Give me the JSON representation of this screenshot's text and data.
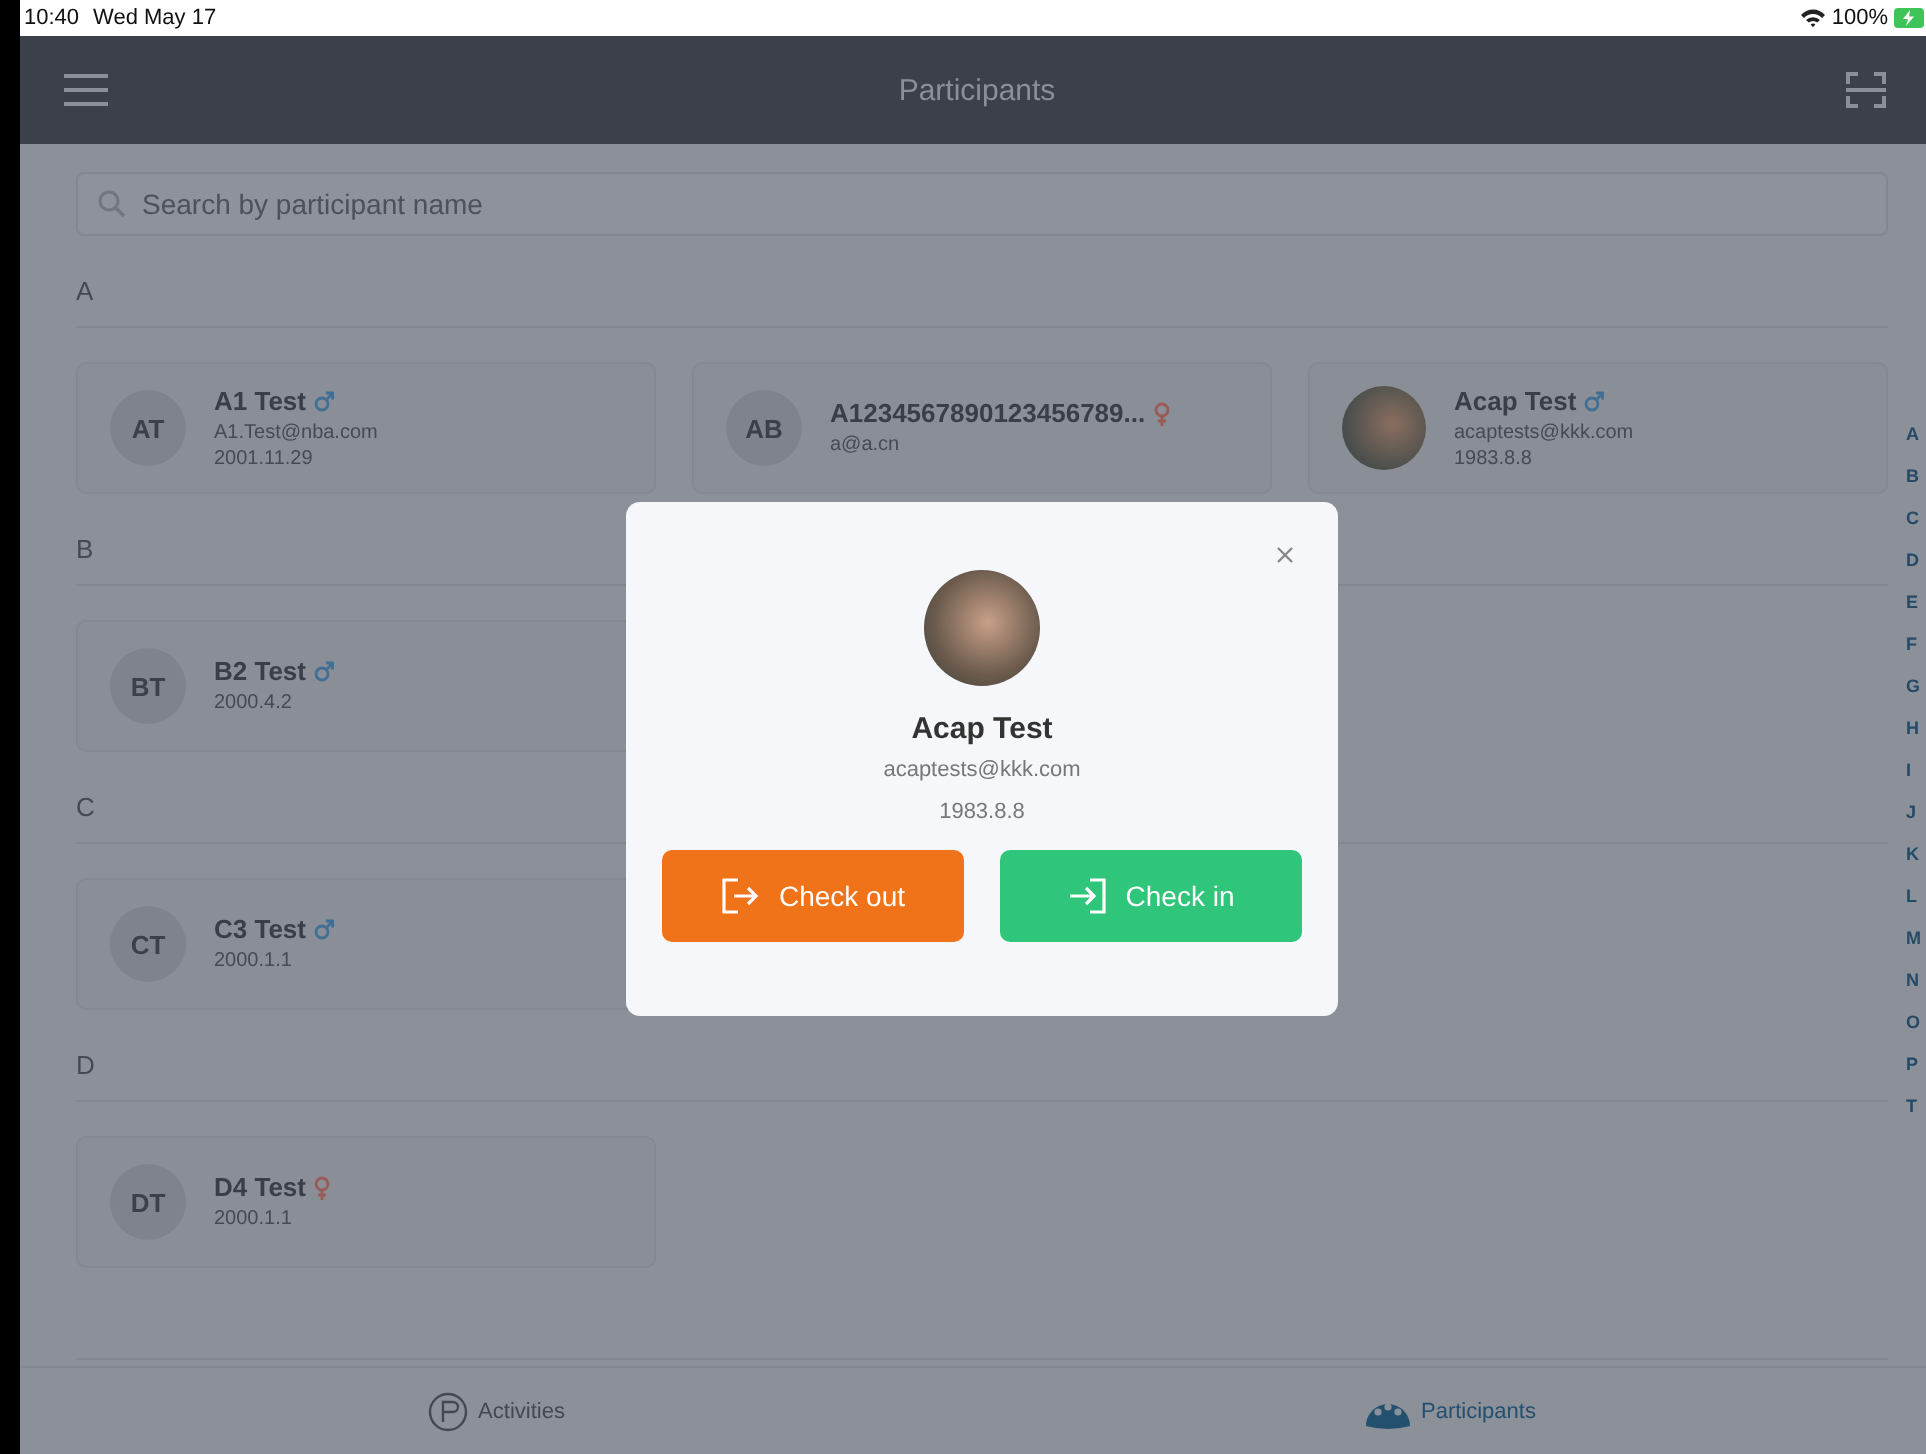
{
  "status_bar": {
    "time": "10:40",
    "date": "Wed May 17",
    "battery": "100%"
  },
  "header": {
    "title": "Participants"
  },
  "search": {
    "placeholder": "Search by participant name"
  },
  "sections": [
    {
      "letter": "A",
      "participants": [
        {
          "name": "A1 Test",
          "kind": "male",
          "avatar": {
            "kind": "initials",
            "text": "AT"
          },
          "lines": [
            "A1.Test@nba.com",
            "2001.11.29"
          ]
        },
        {
          "name": "A1234567890123456789...",
          "kind": "female",
          "avatar": {
            "kind": "initials",
            "text": "AB"
          },
          "lines": [
            "a@a.cn"
          ]
        },
        {
          "name": "Acap Test",
          "kind": "male",
          "avatar": {
            "kind": "photo"
          },
          "lines": [
            "acaptests@kkk.com",
            "1983.8.8"
          ]
        }
      ]
    },
    {
      "letter": "B",
      "participants": [
        {
          "name": "B2 Test",
          "kind": "male",
          "avatar": {
            "kind": "initials",
            "text": "BT"
          },
          "lines": [
            "2000.4.2"
          ]
        }
      ]
    },
    {
      "letter": "C",
      "participants": [
        {
          "name": "C3 Test",
          "kind": "male",
          "avatar": {
            "kind": "initials",
            "text": "CT"
          },
          "lines": [
            "2000.1.1"
          ]
        }
      ]
    },
    {
      "letter": "D",
      "participants": [
        {
          "name": "D4 Test",
          "kind": "female",
          "avatar": {
            "kind": "initials",
            "text": "DT"
          },
          "lines": [
            "2000.1.1"
          ]
        }
      ]
    }
  ],
  "index": [
    "A",
    "B",
    "C",
    "D",
    "E",
    "F",
    "G",
    "H",
    "I",
    "J",
    "K",
    "L",
    "M",
    "N",
    "O",
    "P",
    "T"
  ],
  "modal": {
    "name": "Acap Test",
    "email": "acaptests@kkk.com",
    "date": "1983.8.8",
    "buttons": [
      {
        "kind": "check_out",
        "label": "Check out"
      },
      {
        "kind": "check_in",
        "label": "Check in"
      }
    ]
  },
  "tabs": [
    {
      "label": "Activities",
      "selected": false
    },
    {
      "label": "Participants",
      "selected": true
    }
  ]
}
